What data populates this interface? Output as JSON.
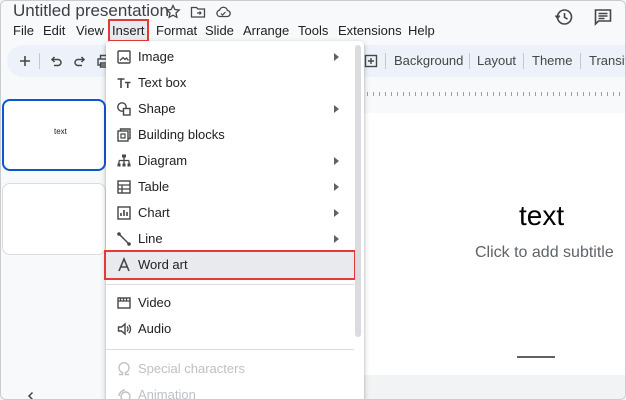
{
  "app": {
    "title": "Untitled presentation",
    "title_icons": [
      "star-icon",
      "move-to-folder-icon",
      "cloud-status-icon"
    ],
    "right_icons": [
      "version-history-icon",
      "comments-icon"
    ]
  },
  "menubar": {
    "items": [
      {
        "label": "File"
      },
      {
        "label": "Edit"
      },
      {
        "label": "View"
      },
      {
        "label": "Insert",
        "active": true
      },
      {
        "label": "Format"
      },
      {
        "label": "Slide"
      },
      {
        "label": "Arrange"
      },
      {
        "label": "Tools"
      },
      {
        "label": "Extensions"
      },
      {
        "label": "Help"
      }
    ]
  },
  "toolbar": {
    "buttons": [
      "add-icon",
      "undo-icon",
      "redo-icon",
      "print-icon",
      "insert-slide-icon"
    ],
    "background_label": "Background",
    "layout_label": "Layout",
    "theme_label": "Theme",
    "transition_label": "Transit"
  },
  "filmstrip": {
    "slides": [
      {
        "text": "text",
        "selected": true
      },
      {
        "text": "",
        "selected": false
      }
    ]
  },
  "slide": {
    "title": "text",
    "subtitle": "Click to add subtitle"
  },
  "insert_menu": {
    "items": [
      {
        "label": "Image",
        "icon": "image-icon",
        "submenu": true
      },
      {
        "label": "Text box",
        "icon": "text-box-icon",
        "submenu": false
      },
      {
        "label": "Shape",
        "icon": "shape-icon",
        "submenu": true
      },
      {
        "label": "Building blocks",
        "icon": "building-blocks-icon",
        "submenu": false
      },
      {
        "label": "Diagram",
        "icon": "diagram-icon",
        "submenu": true
      },
      {
        "label": "Table",
        "icon": "table-icon",
        "submenu": true
      },
      {
        "label": "Chart",
        "icon": "chart-icon",
        "submenu": true
      },
      {
        "label": "Line",
        "icon": "line-icon",
        "submenu": true
      },
      {
        "label": "Word art",
        "icon": "word-art-icon",
        "submenu": false,
        "highlighted": true
      },
      {
        "label": "Video",
        "icon": "video-icon",
        "submenu": false
      },
      {
        "label": "Audio",
        "icon": "audio-icon",
        "submenu": false
      },
      {
        "label": "Special characters",
        "icon": "omega-icon",
        "submenu": false,
        "disabled": true
      },
      {
        "label": "Animation",
        "icon": "animation-icon",
        "submenu": false,
        "disabled": true
      }
    ]
  },
  "colors": {
    "highlight_box": "#e53935",
    "selection_border": "#0b57d0",
    "toolbar_bg": "#edf2fa"
  }
}
